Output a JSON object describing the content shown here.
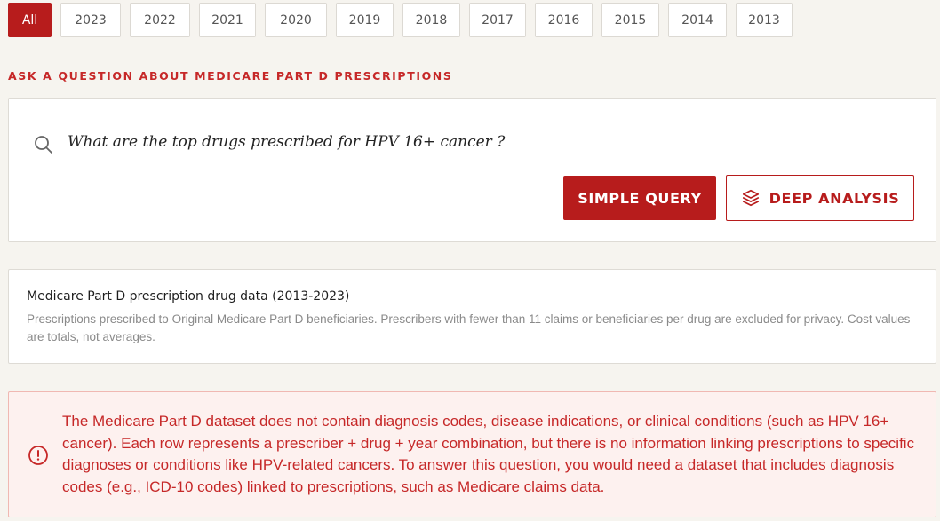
{
  "year_filters": [
    {
      "label": "All",
      "active": true
    },
    {
      "label": "2023",
      "active": false
    },
    {
      "label": "2022",
      "active": false
    },
    {
      "label": "2021",
      "active": false
    },
    {
      "label": "2020",
      "active": false
    },
    {
      "label": "2019",
      "active": false
    },
    {
      "label": "2018",
      "active": false
    },
    {
      "label": "2017",
      "active": false
    },
    {
      "label": "2016",
      "active": false
    },
    {
      "label": "2015",
      "active": false
    },
    {
      "label": "2014",
      "active": false
    },
    {
      "label": "2013",
      "active": false
    }
  ],
  "ask": {
    "heading": "ASK A QUESTION ABOUT MEDICARE PART D PRESCRIPTIONS",
    "query": "What are the top drugs prescribed for HPV 16+ cancer ?",
    "simple_query_label": "SIMPLE QUERY",
    "deep_analysis_label": "DEEP ANALYSIS"
  },
  "dataset": {
    "title": "Medicare Part D prescription drug data (2013-2023)",
    "description": "Prescriptions prescribed to Original Medicare Part D beneficiaries. Prescribers with fewer than 11 claims or beneficiaries per drug are excluded for privacy. Cost values are totals, not averages."
  },
  "alert": {
    "message": "The Medicare Part D dataset does not contain diagnosis codes, disease indications, or clinical conditions (such as HPV 16+ cancer). Each row represents a prescriber + drug + year combination, but there is no information linking prescriptions to specific diagnoses or conditions like HPV-related cancers. To answer this question, you would need a dataset that includes diagnosis codes (e.g., ICD-10 codes) linked to prescriptions, such as Medicare claims data."
  },
  "colors": {
    "accent": "#b71c1c",
    "alert_text": "#c62828",
    "alert_bg": "#fdf1ef",
    "page_bg": "#f6f4ef"
  }
}
